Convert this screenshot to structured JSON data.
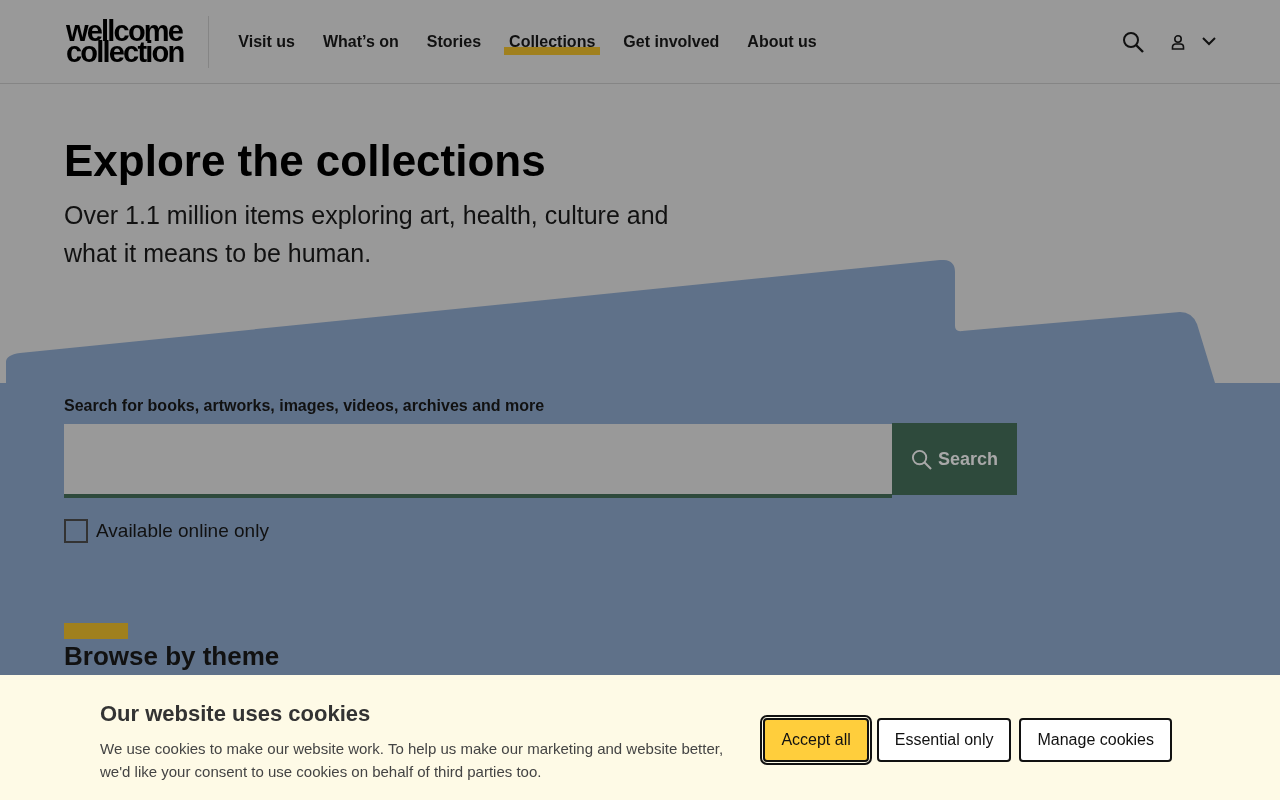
{
  "header": {
    "logo": [
      "wellcome",
      "collection"
    ],
    "nav": [
      {
        "label": "Visit us",
        "selected": false
      },
      {
        "label": "What’s on",
        "selected": false
      },
      {
        "label": "Stories",
        "selected": false
      },
      {
        "label": "Collections",
        "selected": true
      },
      {
        "label": "Get involved",
        "selected": false
      },
      {
        "label": "About us",
        "selected": false
      }
    ]
  },
  "hero": {
    "title": "Explore the collections",
    "subtitle": "Over 1.1 million items exploring art, health, culture and what it means to be human."
  },
  "search": {
    "label": "Search for books, artworks, images, videos, archives and more",
    "button": "Search",
    "filter": {
      "label": "Available online only",
      "checked": false
    }
  },
  "section": {
    "title": "Browse by theme"
  },
  "cookie_banner": {
    "title": "Our website uses cookies",
    "text": "We use cookies to make our website work. To help us make our marketing and website better, we'd like your consent to use cookies on behalf of third parties too.",
    "buttons": [
      {
        "label": "Accept all",
        "kind": "primary",
        "focused": true
      },
      {
        "label": "Essential only",
        "kind": "secondary",
        "focused": false
      },
      {
        "label": "Manage cookies",
        "kind": "secondary",
        "focused": false
      }
    ]
  }
}
